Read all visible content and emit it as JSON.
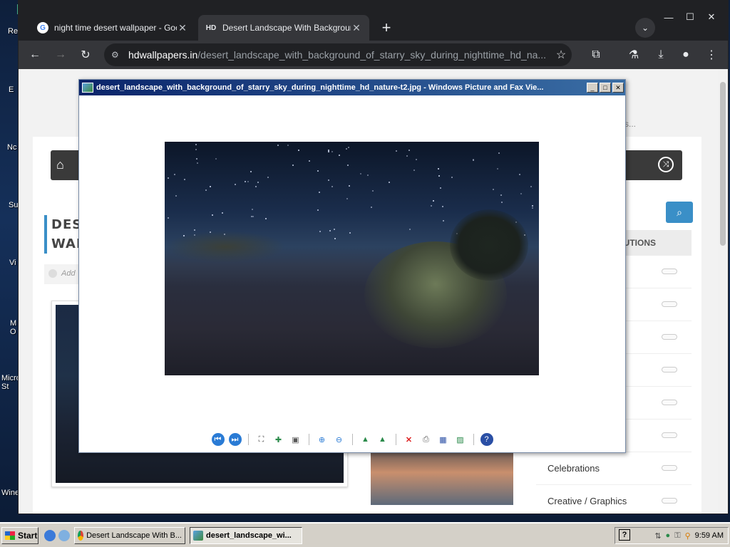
{
  "desktop": {
    "labels": [
      "Re",
      "E",
      "Nc",
      "Su",
      "Vi",
      "M O",
      "Micro St",
      "Wine"
    ]
  },
  "browser": {
    "tabs": [
      {
        "title": "night time desert wallpaper - Goog",
        "favicon": "google-icon",
        "close": "✕"
      },
      {
        "title": "Desert Landscape With Backgrour",
        "favicon": "HD",
        "close": "✕"
      }
    ],
    "new_tab": "+",
    "address_domain": "hdwallpapers.in",
    "address_path": "/desert_landscape_with_background_of_starry_sky_during_nighttime_hd_na...",
    "window_controls": {
      "min": "—",
      "max": "☐",
      "close": "✕"
    }
  },
  "webpage": {
    "page_title": "DESERT LANDSCAPE WITH BACKGROUND OF STARRY SKY DURING NIGHTTIME HD NATURE WALL",
    "title_visible_line1": "DESE",
    "title_visible_line2": "WALL",
    "add_text": "Add",
    "dots": "s...",
    "sidebar_header": "LUTIONS",
    "sidebar_items": [
      "",
      "",
      "",
      "",
      "",
      "",
      "Celebrations",
      "Creative / Graphics"
    ]
  },
  "viewer": {
    "title": "desert_landscape_with_background_of_starry_sky_during_nighttime_hd_nature-t2.jpg - Windows Picture and Fax Vie...",
    "buttons": {
      "min": "_",
      "max": "□",
      "close": "✕"
    }
  },
  "taskbar": {
    "start": "Start",
    "tasks": [
      {
        "label": "Desert Landscape With B...",
        "active": false
      },
      {
        "label": "desert_landscape_wi...",
        "active": true
      }
    ],
    "help": "?",
    "clock": "9:59 AM"
  },
  "colors": {
    "accent_blue": "#3a8fc7",
    "chrome_dark": "#202124",
    "viewer_title_start": "#0a246a",
    "taskbar": "#d4d0c8"
  }
}
